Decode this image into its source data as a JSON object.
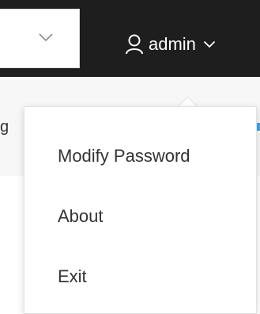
{
  "header": {
    "username": "admin",
    "user_icon": "user-icon",
    "caret_icon": "chevron-down-icon"
  },
  "selector": {
    "icon": "chevron-down-icon"
  },
  "subbar": {
    "partial_text": "g"
  },
  "user_dropdown": {
    "items": [
      {
        "label": "Modify Password"
      },
      {
        "label": "About"
      },
      {
        "label": "Exit"
      }
    ]
  },
  "colors": {
    "topbar": "#1e1e1e",
    "text": "#333333",
    "accent": "#3fa6f0"
  }
}
